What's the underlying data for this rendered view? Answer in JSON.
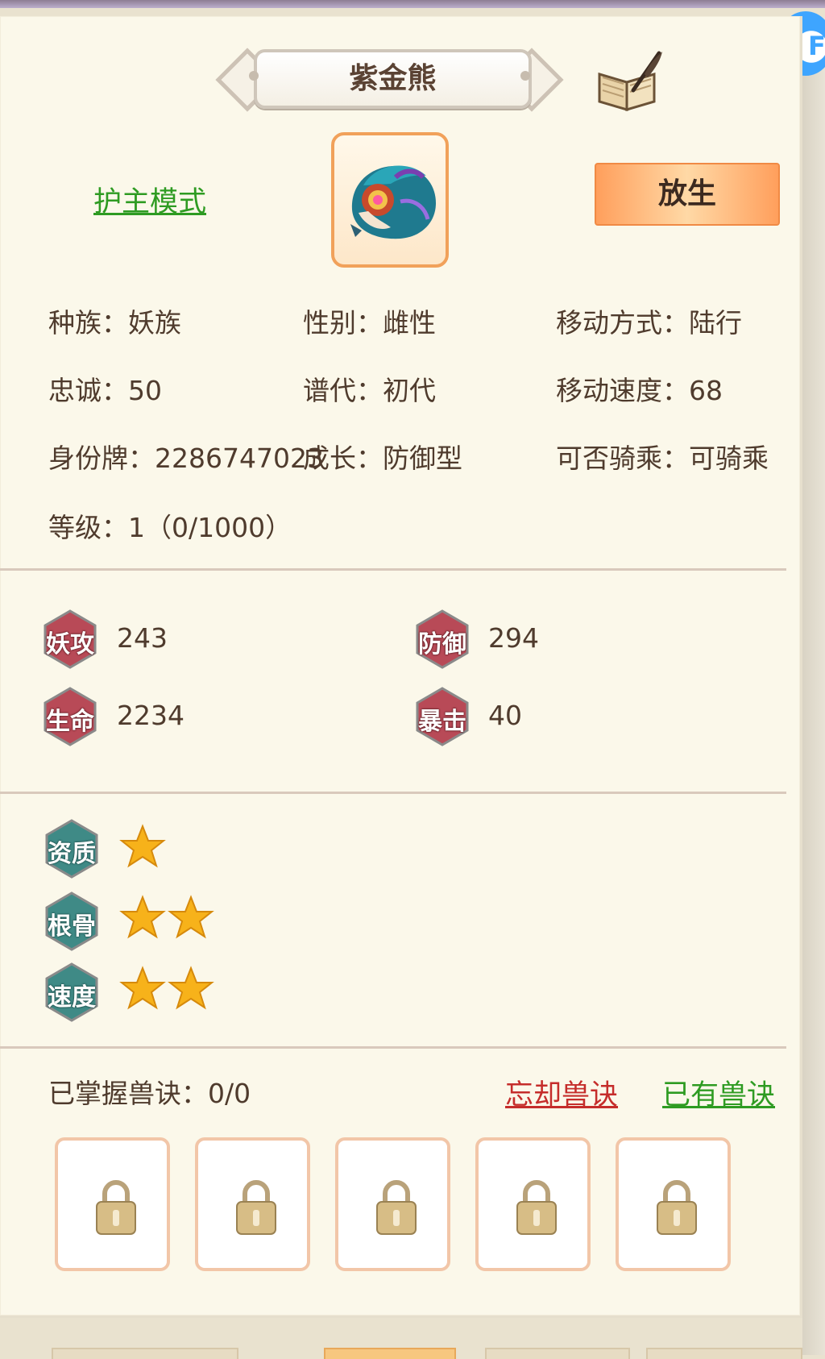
{
  "header": {
    "pet_name": "紫金熊",
    "corner_badge_letter": "F"
  },
  "actions": {
    "guard_mode": "护主模式",
    "release": "放生"
  },
  "info": {
    "race": "种族：妖族",
    "gender": "性别：雌性",
    "move_type": "移动方式：陆行",
    "loyalty": "忠诚：50",
    "generation": "谱代：初代",
    "move_speed": "移动速度：68",
    "id_tag": "身份牌：2286747023",
    "growth": "成长：防御型",
    "rideable": "可否骑乘：可骑乘",
    "level": "等级：1（0/1000）"
  },
  "stats": [
    {
      "label": "妖攻",
      "value": "243"
    },
    {
      "label": "防御",
      "value": "294"
    },
    {
      "label": "生命",
      "value": "2234"
    },
    {
      "label": "暴击",
      "value": "40"
    }
  ],
  "qualities": [
    {
      "label": "资质",
      "stars": 1
    },
    {
      "label": "根骨",
      "stars": 2
    },
    {
      "label": "速度",
      "stars": 2
    }
  ],
  "skills": {
    "mastered": "已掌握兽诀：0/0",
    "forget": "忘却兽诀",
    "owned": "已有兽诀",
    "slots": 5
  },
  "colors": {
    "stat_badge": "#b84a57",
    "quality_badge": "#3f8a86",
    "star": "#f7b21a",
    "green_link": "#2e9b22",
    "red_link": "#c52d2b"
  },
  "icons": [
    "book-quill-icon",
    "lock-icon",
    "star-icon",
    "pet-portrait-icon"
  ]
}
